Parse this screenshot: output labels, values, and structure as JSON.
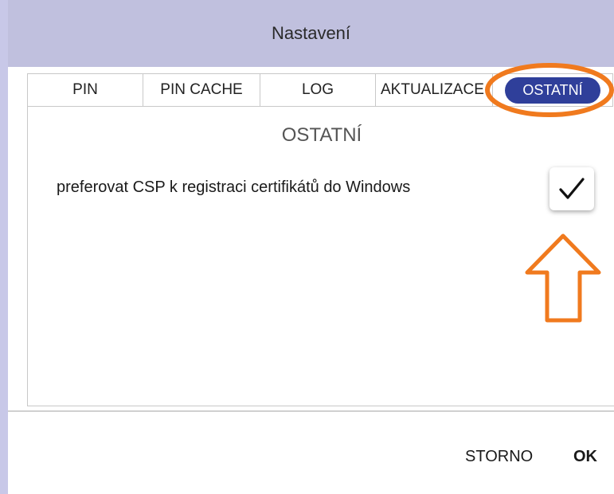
{
  "window": {
    "title": "Nastavení"
  },
  "tabs": [
    {
      "label": "PIN"
    },
    {
      "label": "PIN CACHE"
    },
    {
      "label": "LOG"
    },
    {
      "label": "AKTUALIZACE"
    },
    {
      "label": "OSTATNÍ",
      "active": true
    }
  ],
  "section": {
    "title": "OSTATNÍ"
  },
  "options": [
    {
      "label": "preferovat CSP k registraci certifikátů do Windows",
      "checked": true
    }
  ],
  "footer": {
    "cancel_label": "STORNO",
    "ok_label": "OK"
  },
  "colors": {
    "titlebar": "#c0c0de",
    "active_tab": "#2f3f9a",
    "annotation": "#f07a1e"
  }
}
